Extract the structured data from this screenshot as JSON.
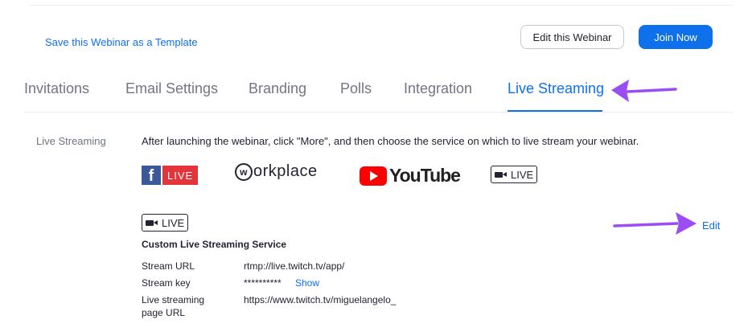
{
  "header": {
    "template_link": "Save this Webinar as a Template",
    "edit_button": "Edit this Webinar",
    "join_button": "Join Now"
  },
  "tabs": [
    {
      "label": "Invitations",
      "active": false
    },
    {
      "label": "Email Settings",
      "active": false
    },
    {
      "label": "Branding",
      "active": false
    },
    {
      "label": "Polls",
      "active": false
    },
    {
      "label": "Integration",
      "active": false
    },
    {
      "label": "Live Streaming",
      "active": true
    }
  ],
  "section": {
    "label": "Live Streaming",
    "instructions": "After launching the webinar, click \"More\", and then choose the service on which to live stream your webinar."
  },
  "services": {
    "facebook_letter": "f",
    "facebook_live": "LIVE",
    "workplace_rest": "orkplace",
    "workplace_w": "w",
    "youtube": "YouTube",
    "custom_live": "LIVE"
  },
  "custom": {
    "badge": "LIVE",
    "title": "Custom Live Streaming Service",
    "edit_link": "Edit",
    "rows": [
      {
        "label": "Stream URL",
        "value": "rtmp://live.twitch.tv/app/"
      },
      {
        "label": "Stream key",
        "value": "**********"
      },
      {
        "label_line1": "Live streaming",
        "label_line2": "page URL",
        "value": "https://www.twitch.tv/miguelangelo_"
      }
    ],
    "show_link": "Show"
  },
  "colors": {
    "accent": "#0e71eb",
    "annotation_arrow": "#9b4df5",
    "facebook": "#3b5998",
    "live_red": "#e2363c",
    "youtube_red": "#ff0000"
  },
  "icons": [
    "facebook-icon",
    "workplace-icon",
    "youtube-icon",
    "video-camera-icon",
    "annotation-arrow"
  ]
}
